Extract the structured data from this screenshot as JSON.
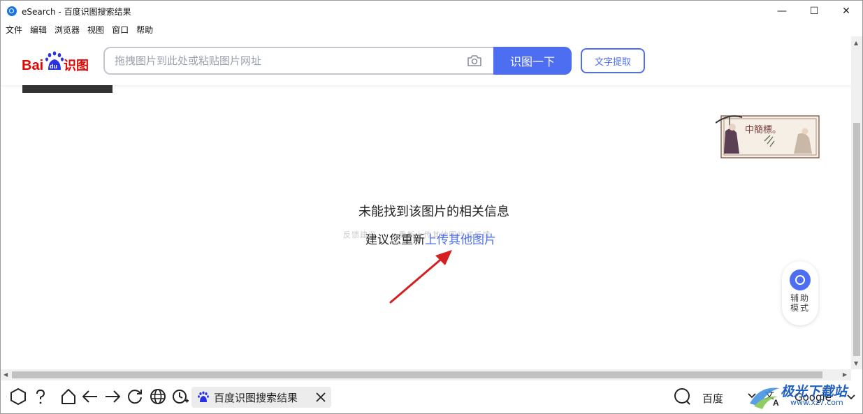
{
  "window": {
    "title": "eSearch - 百度识图搜索结果",
    "minimize": "—",
    "maximize": "☐",
    "close": "✕"
  },
  "menu": [
    "文件",
    "编辑",
    "浏览器",
    "视图",
    "窗口",
    "帮助"
  ],
  "baidu": {
    "logo_text_bai": "Bai",
    "logo_text_du": "du",
    "logo_text_shitu": "识图",
    "search_placeholder": "拖拽图片到此处或粘贴图片网址",
    "search_button": "识图一下",
    "ocr_button": "文字提取"
  },
  "badge": {
    "text": "中簡標。"
  },
  "result": {
    "title": "未能找到该图片的相关信息",
    "faint_text": "反馈建议 ·   ·  ·     重新上传其他图片或反馈",
    "suggest_prefix": "建议您重新",
    "suggest_link": "上传其他图片"
  },
  "assist": {
    "label": "辅助模式"
  },
  "toolbar": {
    "tab_title": "百度识图搜索结果",
    "engine_search": "百度",
    "engine_translate": "Google"
  },
  "watermark": {
    "name": "极光下载站",
    "url": "www.xz7.com"
  },
  "colors": {
    "accent": "#4e6ef2",
    "arrow": "#d42020",
    "baidu_red": "#e10602",
    "baidu_blue": "#2932e1"
  }
}
